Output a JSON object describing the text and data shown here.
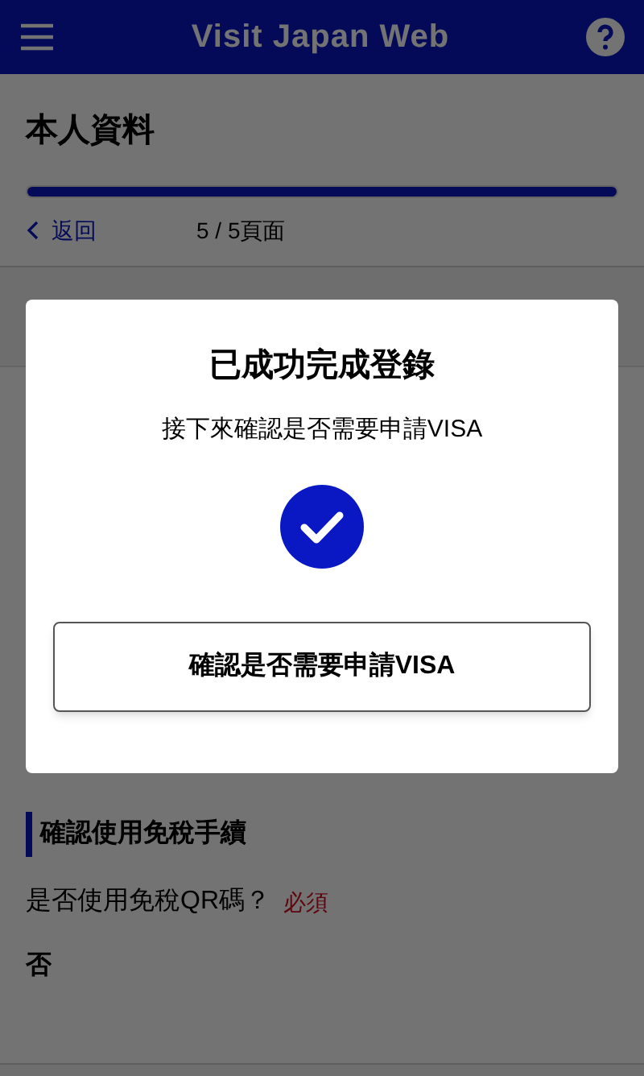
{
  "header": {
    "title": "Visit Japan Web"
  },
  "page": {
    "title": "本人資料",
    "progress": {
      "level": 1
    },
    "back_link": "返回",
    "page_indicator": "5 / 5頁面"
  },
  "section": {
    "heading": "確認使用免稅手續",
    "question": "是否使用免稅QR碼？",
    "required": "必須",
    "answer": "否"
  },
  "dialog": {
    "title": "已成功完成登錄",
    "message": "接下來確認是否需要申請VISA",
    "button": "確認是否需要申請VISA"
  }
}
